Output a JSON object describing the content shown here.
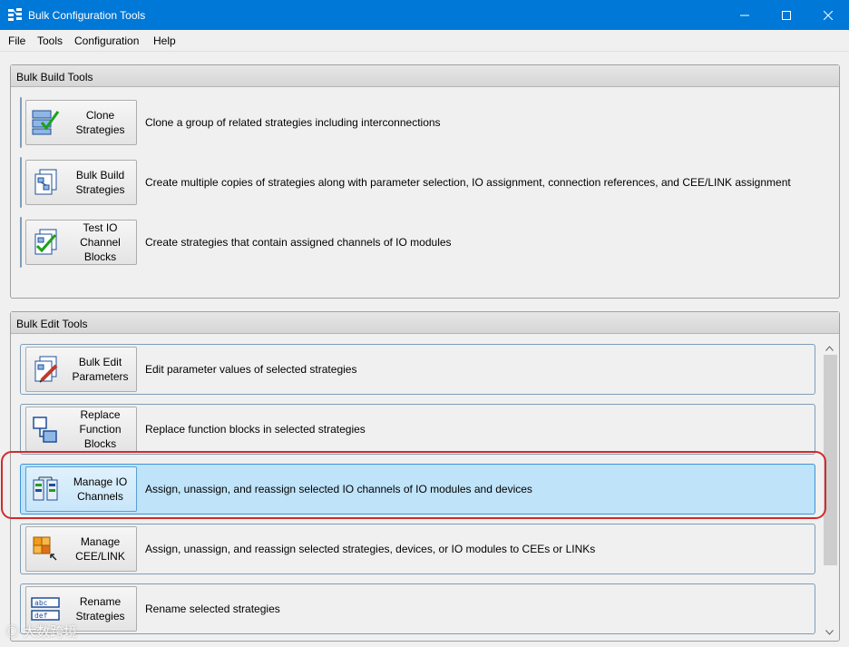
{
  "window": {
    "title": "Bulk Configuration Tools"
  },
  "menu": [
    "File",
    "Tools",
    "Configuration",
    "Help"
  ],
  "build_group": {
    "header": "Bulk Build Tools",
    "tools": [
      {
        "label": [
          "Clone",
          "Strategies"
        ],
        "description": "Clone a group of related strategies including interconnections",
        "icon": "clone-strategies-icon"
      },
      {
        "label": [
          "Bulk Build",
          "Strategies"
        ],
        "description": "Create multiple copies of strategies along with parameter selection, IO assignment, connection references, and CEE/LINK assignment",
        "icon": "bulk-build-icon"
      },
      {
        "label": [
          "Test IO",
          "Channel",
          "Blocks"
        ],
        "description": "Create strategies that contain assigned channels of IO modules",
        "icon": "test-io-icon"
      }
    ]
  },
  "edit_group": {
    "header": "Bulk Edit Tools",
    "tools": [
      {
        "label": [
          "Bulk Edit",
          "Parameters"
        ],
        "description": "Edit parameter values of selected strategies",
        "icon": "bulk-edit-icon"
      },
      {
        "label": [
          "Replace",
          "Function",
          "Blocks"
        ],
        "description": "Replace function blocks in selected strategies",
        "icon": "replace-blocks-icon"
      },
      {
        "label": [
          "Manage IO",
          "Channels"
        ],
        "description": "Assign, unassign, and reassign selected  IO channels of IO modules and devices",
        "icon": "manage-io-icon",
        "selected": true
      },
      {
        "label": [
          "Manage",
          "CEE/LINK"
        ],
        "description": "Assign, unassign, and reassign selected strategies, devices, or IO modules to CEEs or LINKs",
        "icon": "manage-cee-icon"
      },
      {
        "label": [
          "Rename",
          "Strategies"
        ],
        "description": "Rename selected strategies",
        "icon": "rename-icon"
      }
    ]
  },
  "watermark": "大数跨境",
  "colors": {
    "titlebar": "#0078d7",
    "selected_row": "#bfe3f9",
    "highlight": "#d12a2a"
  }
}
